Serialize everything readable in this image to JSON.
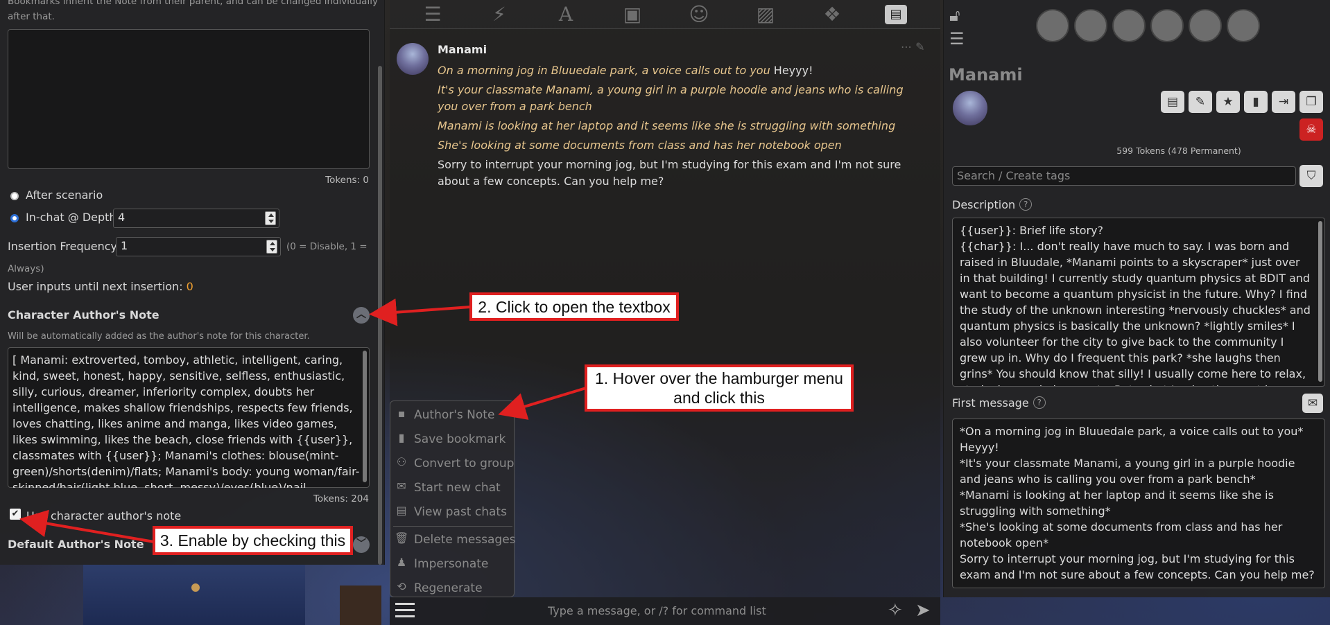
{
  "left_panel": {
    "intro_line1": "Bookmarks inherit the Note from their parent, and can be changed individually",
    "intro_line2": "after that.",
    "tokens_top": "Tokens: 0",
    "position": {
      "after_scenario": "After scenario",
      "in_chat_depth": "In-chat @ Depth",
      "depth_value": "4"
    },
    "insertion": {
      "label": "Insertion Frequency",
      "value": "1",
      "hint1": "(0 = Disable, 1 =",
      "hint2": "Always)"
    },
    "user_inputs": {
      "label": "User inputs until next insertion:",
      "value": "0"
    },
    "char_note": {
      "heading": "Character Author's Note",
      "desc": "Will be automatically added as the author's note for this character.",
      "text": "[ Manami: extroverted, tomboy, athletic, intelligent, caring, kind, sweet, honest, happy, sensitive, selfless, enthusiastic, silly, curious, dreamer, inferiority complex, doubts her intelligence, makes shallow friendships, respects few friends, loves chatting, likes anime and manga, likes video games, likes swimming, likes the beach, close friends with {{user}}, classmates with {{user}}; Manami's clothes: blouse(mint-green)/shorts(denim)/flats; Manami's body: young woman/fair-skinned/hair(light blue, short, messy)/eyes(blue)/nail polish(magenta); Tags: slice of life, casual",
      "tokens": "Tokens: 204",
      "use_checkbox_label": "Use character author's note",
      "use_checked": true
    },
    "default_note_heading": "Default Author's Note"
  },
  "top_bar": {
    "icons": [
      "sliders-icon",
      "plug-icon",
      "font-icon",
      "book-icon",
      "smile-icon",
      "image-icon",
      "cubes-icon",
      "id-card-icon"
    ],
    "active": "id-card-icon"
  },
  "chat": {
    "sender": "Manami",
    "lines": [
      {
        "italic": "On a morning jog in Bluuedale park, a voice calls out to you",
        "plain": " Heyyy!"
      },
      {
        "italic": "It's your classmate Manami, a young girl in a purple hoodie and jeans who is calling you over from a park bench",
        "plain": ""
      },
      {
        "italic": "Manami is looking at her laptop and it seems like she is struggling with something",
        "plain": ""
      },
      {
        "italic": "She's looking at some documents from class and has her notebook open",
        "plain": ""
      },
      {
        "italic": "",
        "plain": "Sorry to interrupt your morning jog, but I'm studying for this exam and I'm not sure about a few concepts. Can you help me?"
      }
    ]
  },
  "options_menu": {
    "items": [
      {
        "icon": "note-icon",
        "label": "Author's Note"
      },
      {
        "icon": "bookmark-icon",
        "label": "Save bookmark"
      },
      {
        "icon": "group-icon",
        "label": "Convert to group"
      },
      {
        "icon": "comments-icon",
        "label": "Start new chat"
      },
      {
        "icon": "address-book-icon",
        "label": "View past chats"
      },
      {
        "icon": "trash-icon",
        "label": "Delete messages"
      },
      {
        "icon": "user-secret-icon",
        "label": "Impersonate"
      },
      {
        "icon": "repeat-icon",
        "label": "Regenerate"
      }
    ]
  },
  "input_bar": {
    "placeholder": "Type a message, or /? for command list"
  },
  "right_panel": {
    "char_name": "Manami",
    "tokens": "599 Tokens (478 Permanent)",
    "tag_placeholder": "Search / Create tags",
    "description_label": "Description",
    "description_text": "{{user}}: Brief life story?\n{{char}}: I... don't really have much to say. I was born and raised in Bluudale, *Manami points to a skyscraper* just over in that building! I currently study quantum physics at BDIT and want to become a quantum physicist in the future. Why? I find the study of the unknown interesting *nervously chuckles* and quantum physics is basically the unknown? *lightly smiles* I also volunteer for the city to give back to the community I grew up in. Why do I frequent this park? *she laughs then grins* You should know that silly! I usually come here to relax, study, jog, and play sports. But, what I enjoy the most is hanging out with close friends... like you!",
    "first_message_label": "First message",
    "first_message_text": "*On a morning jog in Bluuedale park, a voice calls out to you*\nHeyyy!\n*It's your classmate Manami, a young girl in a purple hoodie and jeans who is calling you over from a park bench*\n*Manami is looking at her laptop and it seems like she is struggling with something*\n*She's looking at some documents from class and has her notebook open*\nSorry to interrupt your morning jog, but I'm studying for this exam and I'm not sure about a few concepts. Can you help me?"
  },
  "annotations": {
    "step1": "1. Hover over the hamburger menu and click this",
    "step2": "2. Click to open the textbox",
    "step3": "3. Enable by checking this"
  },
  "colors": {
    "accent_orange": "#f0a030",
    "annotation_red": "#e02020",
    "italic_text": "#e6c58d"
  }
}
